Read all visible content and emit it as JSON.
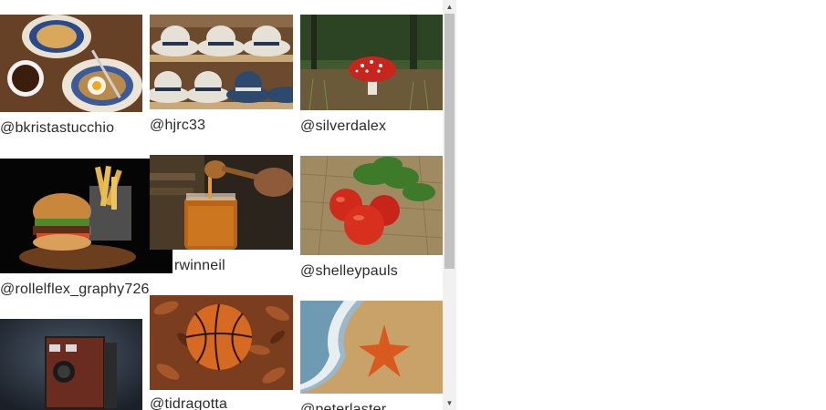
{
  "gallery": {
    "items": [
      {
        "handle": "@bkristastucchio",
        "photo": "breakfast plates with coffee and fried egg"
      },
      {
        "handle": "@hjrc33",
        "photo": "straw hats on shelves"
      },
      {
        "handle": "@silverdalex",
        "photo": "red spotted mushroom in forest"
      },
      {
        "handle": "@rollelflex_graphy726",
        "photo": "burger and fries on board"
      },
      {
        "handle": "rwinneil",
        "photo": "honey dipper over jar"
      },
      {
        "handle": "@shelleypauls",
        "photo": "tomatoes and basil on burlap"
      },
      {
        "handle": "",
        "photo": "vintage box camera"
      },
      {
        "handle": "@tidragotta",
        "photo": "basketball on autumn leaves"
      },
      {
        "handle": "@peterlaster",
        "photo": "starfish on beach"
      }
    ]
  },
  "scrollbar": {
    "up_glyph": "▲",
    "down_glyph": "▼"
  }
}
